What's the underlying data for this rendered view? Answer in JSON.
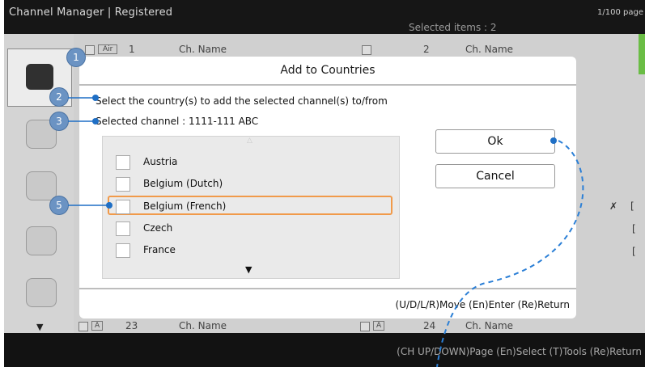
{
  "header": {
    "title": "Channel Manager | Registered",
    "page_indicator": "1/100 page",
    "selected_items": "Selected items : 2"
  },
  "list": {
    "row_first": {
      "badge": "Air",
      "left_num": "1",
      "left_name": "Ch. Name",
      "right_num": "2",
      "right_name": "Ch. Name"
    },
    "row_last": {
      "badge": "A",
      "left_num": "23",
      "left_name": "Ch. Name",
      "right_num": "24",
      "right_name": "Ch. Name"
    }
  },
  "dialog": {
    "title": "Add  to Countries",
    "instruction": "Select the country(s) to add the selected channel(s) to/from",
    "selected_channel": "Selected channel : 1111-111 ABC",
    "countries": [
      {
        "label": "Austria",
        "checked": false
      },
      {
        "label": "Belgium (Dutch)",
        "checked": false
      },
      {
        "label": "Belgium (French)",
        "checked": false,
        "focused": true
      },
      {
        "label": "Czech",
        "checked": false
      },
      {
        "label": "France",
        "checked": false
      }
    ],
    "ok_label": "Ok",
    "cancel_label": "Cancel",
    "footer_hint": "(U/D/L/R)Move  (En)Enter  (Re)Return"
  },
  "footer": {
    "hint": "(CH UP/DOWN)Page  (En)Select  (T)Tools  (Re)Return"
  },
  "callouts": {
    "c1": "1",
    "c2": "2",
    "c3": "3",
    "c5": "5"
  },
  "colors": {
    "focus_border": "#f19a4a",
    "callout_fill": "#6b93c3",
    "connector": "#1f6fc5"
  }
}
